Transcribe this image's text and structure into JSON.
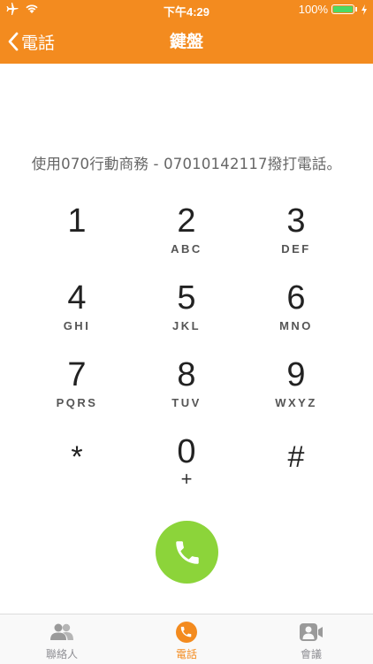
{
  "status_bar": {
    "time": "下午4:29",
    "battery_percent": "100%"
  },
  "nav": {
    "back_label": "電話",
    "title": "鍵盤"
  },
  "info_text": "使用070行動商務 - 07010142117撥打電話。",
  "keypad": [
    {
      "digit": "1",
      "letters": ""
    },
    {
      "digit": "2",
      "letters": "ABC"
    },
    {
      "digit": "3",
      "letters": "DEF"
    },
    {
      "digit": "4",
      "letters": "GHI"
    },
    {
      "digit": "5",
      "letters": "JKL"
    },
    {
      "digit": "6",
      "letters": "MNO"
    },
    {
      "digit": "7",
      "letters": "PQRS"
    },
    {
      "digit": "8",
      "letters": "TUV"
    },
    {
      "digit": "9",
      "letters": "WXYZ"
    },
    {
      "digit": "*",
      "letters": ""
    },
    {
      "digit": "0",
      "letters": "+"
    },
    {
      "digit": "#",
      "letters": ""
    }
  ],
  "tabs": [
    {
      "label": "聯絡人",
      "icon": "contacts-icon",
      "active": false
    },
    {
      "label": "電話",
      "icon": "phone-icon",
      "active": true
    },
    {
      "label": "會議",
      "icon": "conference-icon",
      "active": false
    }
  ],
  "colors": {
    "brand": "#f38b1f",
    "call": "#8cd43a",
    "battery": "#4cd964"
  }
}
